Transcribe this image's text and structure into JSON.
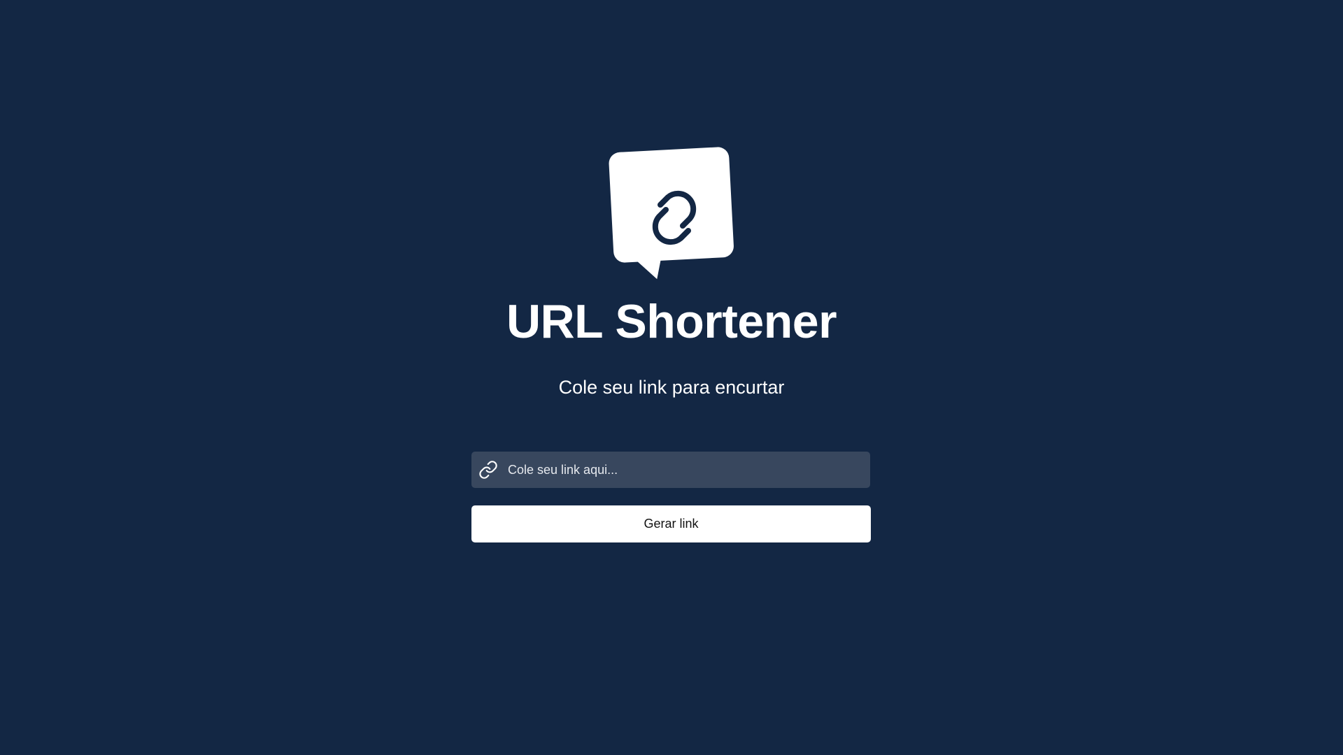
{
  "app": {
    "title": "URL Shortener",
    "subtitle": "Cole seu link para encurtar",
    "logo_icon": "chain-link-speech-bubble-icon"
  },
  "form": {
    "input_icon": "link-icon",
    "input_placeholder": "Cole seu link aqui...",
    "input_value": "",
    "submit_label": "Gerar link"
  },
  "colors": {
    "background": "#132744",
    "input_background": "#38475e",
    "button_background": "#ffffff",
    "text": "#ffffff",
    "button_text": "#111111"
  }
}
